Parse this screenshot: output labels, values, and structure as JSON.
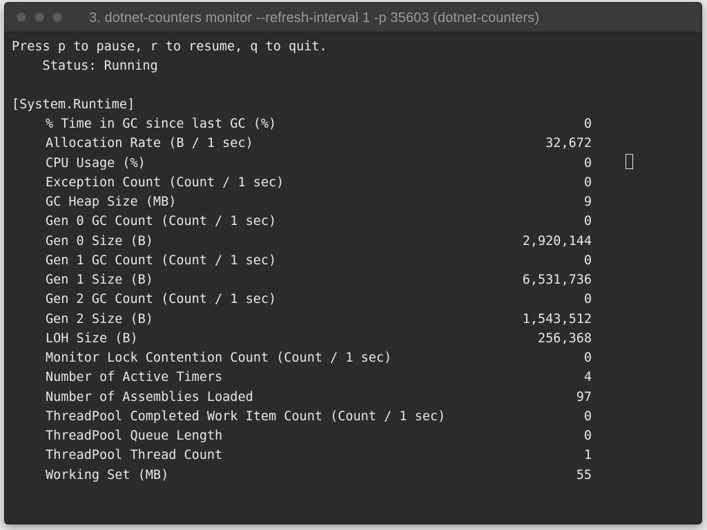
{
  "window": {
    "title": "3. dotnet-counters monitor --refresh-interval 1 -p 35603 (dotnet-counters)"
  },
  "terminal": {
    "instructions": "Press p to pause, r to resume, q to quit.",
    "status": "    Status: Running",
    "section": "[System.Runtime]",
    "counters": [
      {
        "label": "% Time in GC since last GC (%)",
        "value": "0"
      },
      {
        "label": "Allocation Rate (B / 1 sec)",
        "value": "32,672"
      },
      {
        "label": "CPU Usage (%)",
        "value": "0"
      },
      {
        "label": "Exception Count (Count / 1 sec)",
        "value": "0"
      },
      {
        "label": "GC Heap Size (MB)",
        "value": "9"
      },
      {
        "label": "Gen 0 GC Count (Count / 1 sec)",
        "value": "0"
      },
      {
        "label": "Gen 0 Size (B)",
        "value": "2,920,144"
      },
      {
        "label": "Gen 1 GC Count (Count / 1 sec)",
        "value": "0"
      },
      {
        "label": "Gen 1 Size (B)",
        "value": "6,531,736"
      },
      {
        "label": "Gen 2 GC Count (Count / 1 sec)",
        "value": "0"
      },
      {
        "label": "Gen 2 Size (B)",
        "value": "1,543,512"
      },
      {
        "label": "LOH Size (B)",
        "value": "256,368"
      },
      {
        "label": "Monitor Lock Contention Count (Count / 1 sec)",
        "value": "0"
      },
      {
        "label": "Number of Active Timers",
        "value": "4"
      },
      {
        "label": "Number of Assemblies Loaded",
        "value": "97"
      },
      {
        "label": "ThreadPool Completed Work Item Count (Count / 1 sec)",
        "value": "0"
      },
      {
        "label": "ThreadPool Queue Length",
        "value": "0"
      },
      {
        "label": "ThreadPool Thread Count",
        "value": "1"
      },
      {
        "label": "Working Set (MB)",
        "value": "55"
      }
    ]
  }
}
